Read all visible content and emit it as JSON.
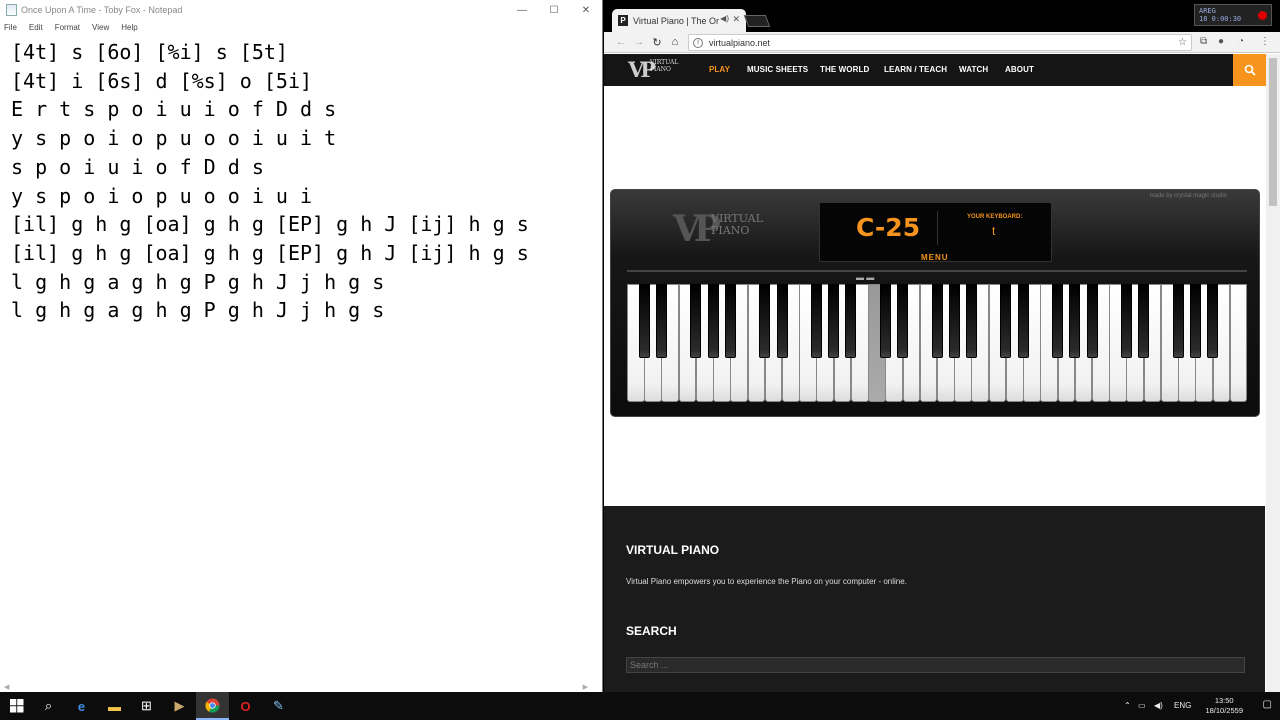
{
  "notepad": {
    "title": "Once Upon A Time - Toby Fox - Notepad",
    "menu": [
      "File",
      "Edit",
      "Format",
      "View",
      "Help"
    ],
    "lines": [
      "[4t] s [6o] [%i] s [5t]",
      "[4t] i [6s] d [%s] o [5i]",
      "E r t s p o i u i o f D d s",
      "y s p o i o p u o o i u i t",
      "s p o i u i o f D d s",
      "y s p o i o p u o o i u i",
      "[il] g h g [oa] g h g [EP] g h J [ij] h g s",
      "[il] g h g [oa] g h g [EP] g h J [ij] h g s",
      "l g h g a g h g P g h J j h g s",
      "l g h g a g h g P g h J j h g s"
    ]
  },
  "browser": {
    "tab_title": "Virtual Piano | The Or",
    "tab_favicon": "P",
    "url": "virtualpiano.net",
    "recorder": {
      "line1": "AREG",
      "line2": "18  0:00:30"
    }
  },
  "site": {
    "logo_text": "VIRTUAL PIANO",
    "nav": [
      {
        "label": "PLAY",
        "active": true
      },
      {
        "label": "MUSIC SHEETS",
        "active": false
      },
      {
        "label": "THE WORLD",
        "active": false
      },
      {
        "label": "LEARN / TEACH",
        "active": false
      },
      {
        "label": "WATCH",
        "active": false
      },
      {
        "label": "ABOUT",
        "active": false
      }
    ],
    "accent_color": "#f7941d"
  },
  "piano": {
    "credit": "made by crystal magic studio",
    "logo_text": "VIRTUAL PIANO",
    "note": "C-25",
    "keyboard_label": "YOUR KEYBOARD:",
    "keyboard_key": "t",
    "menu_label": "MENU",
    "white_key_count": 36,
    "pressed_white_key_index": 14
  },
  "footer": {
    "heading1": "VIRTUAL PIANO",
    "description": "Virtual Piano empowers you to experience the Piano on your computer - online.",
    "heading2": "SEARCH",
    "search_placeholder": "Search ..."
  },
  "taskbar": {
    "language": "ENG",
    "time": "13:50",
    "date": "18/10/2559"
  }
}
